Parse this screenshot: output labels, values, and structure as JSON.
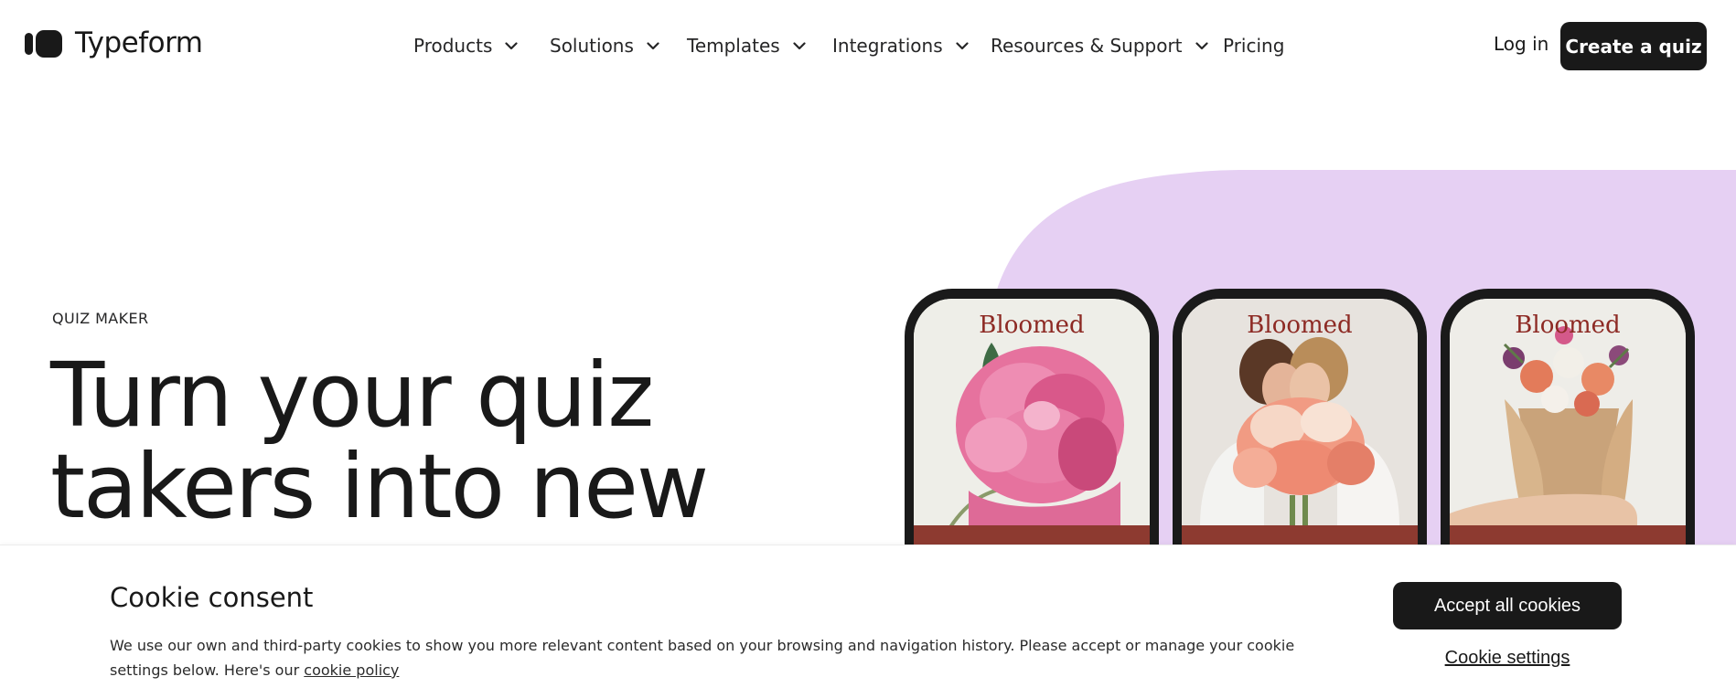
{
  "header": {
    "logo_text": "Typeform",
    "nav": [
      {
        "label": "Products",
        "has_dropdown": true
      },
      {
        "label": "Solutions",
        "has_dropdown": true
      },
      {
        "label": "Templates",
        "has_dropdown": true
      },
      {
        "label": "Integrations",
        "has_dropdown": true
      },
      {
        "label": "Resources & Support",
        "has_dropdown": true
      },
      {
        "label": "Pricing",
        "has_dropdown": false
      }
    ],
    "login_label": "Log in",
    "cta_label": "Create a quiz"
  },
  "hero": {
    "eyebrow": "QUIZ MAKER",
    "headline_lines": [
      "Turn your quiz",
      "takers into new"
    ],
    "accent_color": "#e6d0f3",
    "phones": [
      {
        "brand": "Bloomed",
        "image": "pink-peony-image"
      },
      {
        "brand": "Bloomed",
        "image": "couple-with-flowers-image"
      },
      {
        "brand": "Bloomed",
        "image": "bouquet-in-hand-image"
      }
    ]
  },
  "cookie": {
    "title": "Cookie consent",
    "text": "We use our own and third-party cookies to show you more relevant content based on your browsing and navigation history. Please accept or manage your cookie settings below. Here's our ",
    "policy_link": "cookie policy",
    "accept_label": "Accept all cookies",
    "settings_label": "Cookie settings"
  },
  "colors": {
    "dark": "#191919",
    "lavender": "#e6d0f3",
    "brand_red": "#8d2a24",
    "band_red": "#8d3a30"
  }
}
